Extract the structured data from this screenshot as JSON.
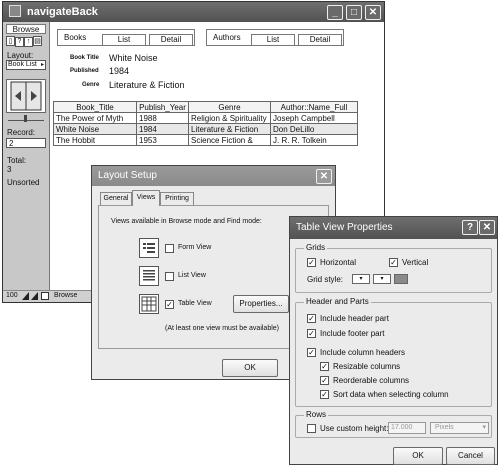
{
  "main_window": {
    "title": "navigateBack",
    "status_area": {
      "mode": "Browse",
      "layout_label": "Layout:",
      "layout_value": "Book List",
      "record_label": "Record:",
      "record_value": "2",
      "total_label": "Total:",
      "total_value": "3",
      "sort_status": "Unsorted"
    },
    "bottom_bar": {
      "zoom": "100",
      "mode": "Browse"
    },
    "books_tab": {
      "title": "Books",
      "tabs": [
        "List",
        "Detail"
      ]
    },
    "authors_tab": {
      "title": "Authors",
      "tabs": [
        "List",
        "Detail"
      ]
    },
    "detail": {
      "book_title_label": "Book Title",
      "book_title_value": "White Noise",
      "published_label": "Published",
      "published_value": "1984",
      "genre_label": "Genre",
      "genre_value": "Literature & Fiction"
    },
    "table": {
      "headers": [
        "Book_Title",
        "Publish_Year",
        "Genre",
        "Author::Name_Full"
      ],
      "rows": [
        [
          "The Power of Myth",
          "1988",
          "Religion & Spirituality",
          "Joseph Campbell"
        ],
        [
          "White Noise",
          "1984",
          "Literature & Fiction",
          "Don DeLillo"
        ],
        [
          "The Hobbit",
          "1953",
          "Science Fiction &",
          "J. R. R. Tolkein"
        ]
      ]
    }
  },
  "layout_setup": {
    "title": "Layout Setup",
    "close_glyph": "✕",
    "tabs": [
      "General",
      "Views",
      "Printing"
    ],
    "description": "Views available in Browse mode and Find mode:",
    "views": [
      {
        "label": "Form View",
        "checked": false
      },
      {
        "label": "List View",
        "checked": false
      },
      {
        "label": "Table View",
        "checked": true
      }
    ],
    "properties_button": "Properties...",
    "note": "(At least one view must be available)",
    "ok_button": "OK"
  },
  "table_view_properties": {
    "title": "Table View Properties",
    "help_glyph": "?",
    "close_glyph": "✕",
    "grids": {
      "title": "Grids",
      "horizontal": "Horizontal",
      "vertical": "Vertical",
      "grid_style_label": "Grid style:"
    },
    "header_parts": {
      "title": "Header and Parts",
      "include_header": "Include header part",
      "include_footer": "Include footer part",
      "include_column_headers": "Include column headers",
      "resizable": "Resizable columns",
      "reorderable": "Reorderable columns",
      "sort_data": "Sort data when selecting column"
    },
    "rows": {
      "title": "Rows",
      "custom_height_label": "Use custom height:",
      "custom_height_value": "17.000",
      "unit": "Pixels"
    },
    "ok_button": "OK",
    "cancel_button": "Cancel"
  }
}
